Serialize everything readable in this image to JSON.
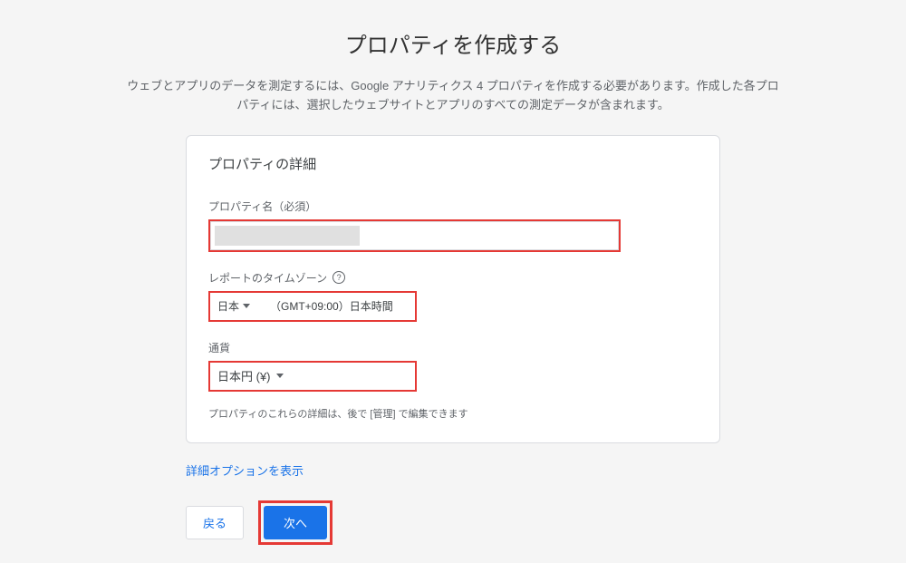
{
  "page": {
    "title": "プロパティを作成する",
    "description": "ウェブとアプリのデータを測定するには、Google アナリティクス 4 プロパティを作成する必要があります。作成した各プロパティには、選択したウェブサイトとアプリのすべての測定データが含まれます。"
  },
  "card": {
    "title": "プロパティの詳細",
    "propertyName": {
      "label": "プロパティ名（必須）",
      "value": ""
    },
    "timezone": {
      "label": "レポートのタイムゾーン",
      "country": "日本",
      "detail": "（GMT+09:00）日本時間"
    },
    "currency": {
      "label": "通貨",
      "value": "日本円 (¥)"
    },
    "hint": "プロパティのこれらの詳細は、後で [管理] で編集できます"
  },
  "belowCard": {
    "advancedLink": "詳細オプションを表示",
    "backButton": "戻る",
    "nextButton": "次へ"
  }
}
